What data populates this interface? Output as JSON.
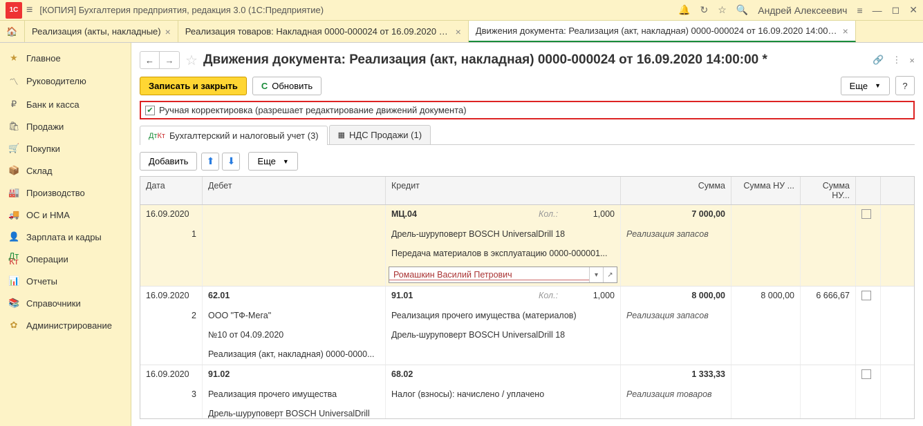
{
  "titlebar": {
    "app_title": "[КОПИЯ] Бухгалтерия предприятия, редакция 3.0  (1С:Предприятие)",
    "username": "Андрей Алексеевич"
  },
  "tabs": [
    {
      "label": "Реализация (акты, накладные)"
    },
    {
      "label": "Реализация товаров: Накладная 0000-000024 от 16.09.2020 14:00:00"
    },
    {
      "label": "Движения документа: Реализация (акт, накладная) 0000-000024 от 16.09.2020 14:00:00 *"
    }
  ],
  "sidebar": {
    "items": [
      {
        "icon": "★",
        "label": "Главное"
      },
      {
        "icon": "📈",
        "label": "Руководителю"
      },
      {
        "icon": "₽",
        "label": "Банк и касса"
      },
      {
        "icon": "🛍",
        "label": "Продажи"
      },
      {
        "icon": "🛒",
        "label": "Покупки"
      },
      {
        "icon": "📦",
        "label": "Склад"
      },
      {
        "icon": "🏭",
        "label": "Производство"
      },
      {
        "icon": "🚚",
        "label": "ОС и НМА"
      },
      {
        "icon": "👤",
        "label": "Зарплата и кадры"
      },
      {
        "icon": "Дт",
        "label": "Операции"
      },
      {
        "icon": "📊",
        "label": "Отчеты"
      },
      {
        "icon": "📚",
        "label": "Справочники"
      },
      {
        "icon": "⚙",
        "label": "Администрирование"
      }
    ]
  },
  "page": {
    "title": "Движения документа: Реализация (акт, накладная) 0000-000024 от 16.09.2020 14:00:00 *",
    "save_close": "Записать и закрыть",
    "refresh": "Обновить",
    "more": "Еще",
    "help": "?",
    "manual_check": "Ручная корректировка (разрешает редактирование движений документа)"
  },
  "subtabs": [
    {
      "label": "Бухгалтерский и налоговый учет (3)"
    },
    {
      "label": "НДС Продажи (1)"
    }
  ],
  "table_toolbar": {
    "add": "Добавить",
    "more": "Еще"
  },
  "columns": {
    "date": "Дата",
    "debit": "Дебет",
    "credit": "Кредит",
    "sum": "Сумма",
    "sumnu": "Сумма НУ ...",
    "sumnu2": "Сумма НУ..."
  },
  "rows": [
    {
      "date": "16.09.2020",
      "num": "1",
      "credit_acc": "МЦ.04",
      "kol_label": "Кол.:",
      "qty": "1,000",
      "sum": "7 000,00",
      "credit_line2": "Дрель-шуруповерт BOSCH UniversalDrill 18",
      "sum_note": "Реализация запасов",
      "credit_line3": "Передача материалов в эксплуатацию 0000-000001...",
      "input_value": "Ромашкин Василий Петрович"
    },
    {
      "date": "16.09.2020",
      "num": "2",
      "debit_acc": "62.01",
      "credit_acc": "91.01",
      "kol_label": "Кол.:",
      "qty": "1,000",
      "sum": "8 000,00",
      "sumnu": "8 000,00",
      "sumnu2": "6 666,67",
      "debit_line2": "ООО \"ТФ-Мега\"",
      "credit_line2": "Реализация прочего имущества (материалов)",
      "sum_note": "Реализация запасов",
      "debit_line3": "№10 от 04.09.2020",
      "credit_line3": "Дрель-шуруповерт BOSCH UniversalDrill 18",
      "debit_line4": "Реализация (акт, накладная) 0000-0000..."
    },
    {
      "date": "16.09.2020",
      "num": "3",
      "debit_acc": "91.02",
      "credit_acc": "68.02",
      "sum": "1 333,33",
      "debit_line2": "Реализация прочего имущества",
      "credit_line2": "Налог (взносы): начислено / уплачено",
      "sum_note": "Реализация товаров",
      "debit_line3": "Дрель-шуруповерт BOSCH UniversalDrill"
    }
  ]
}
